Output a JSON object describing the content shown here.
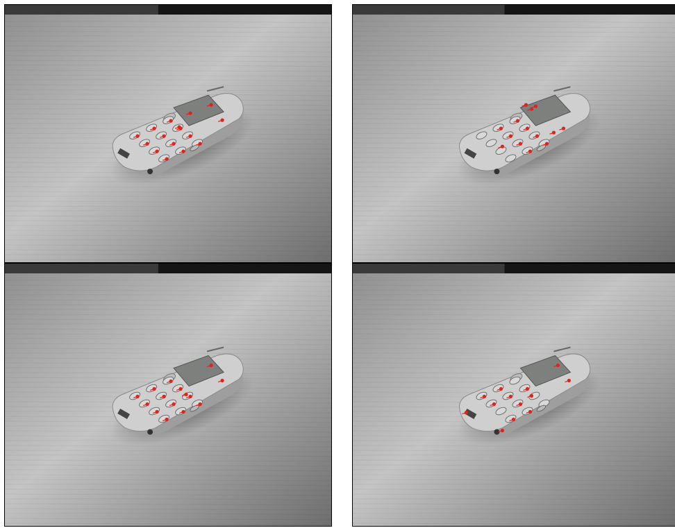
{
  "figure": {
    "layout": "2x2 grid",
    "colors": {
      "marker": "#e0241c",
      "frame": "#000000",
      "table_light": "#c4c4c4",
      "table_dark": "#6e6e6e",
      "phone_body": "#cfcfcf"
    },
    "panels": [
      {
        "id": "top-left",
        "subject": "mobile-phone-on-wooden-table",
        "marker_set": "A"
      },
      {
        "id": "top-right",
        "subject": "mobile-phone-on-wooden-table",
        "marker_set": "B"
      },
      {
        "id": "bottom-left",
        "subject": "mobile-phone-on-wooden-table",
        "marker_set": "C"
      },
      {
        "id": "bottom-right",
        "subject": "mobile-phone-on-wooden-table",
        "marker_set": "D"
      }
    ]
  }
}
